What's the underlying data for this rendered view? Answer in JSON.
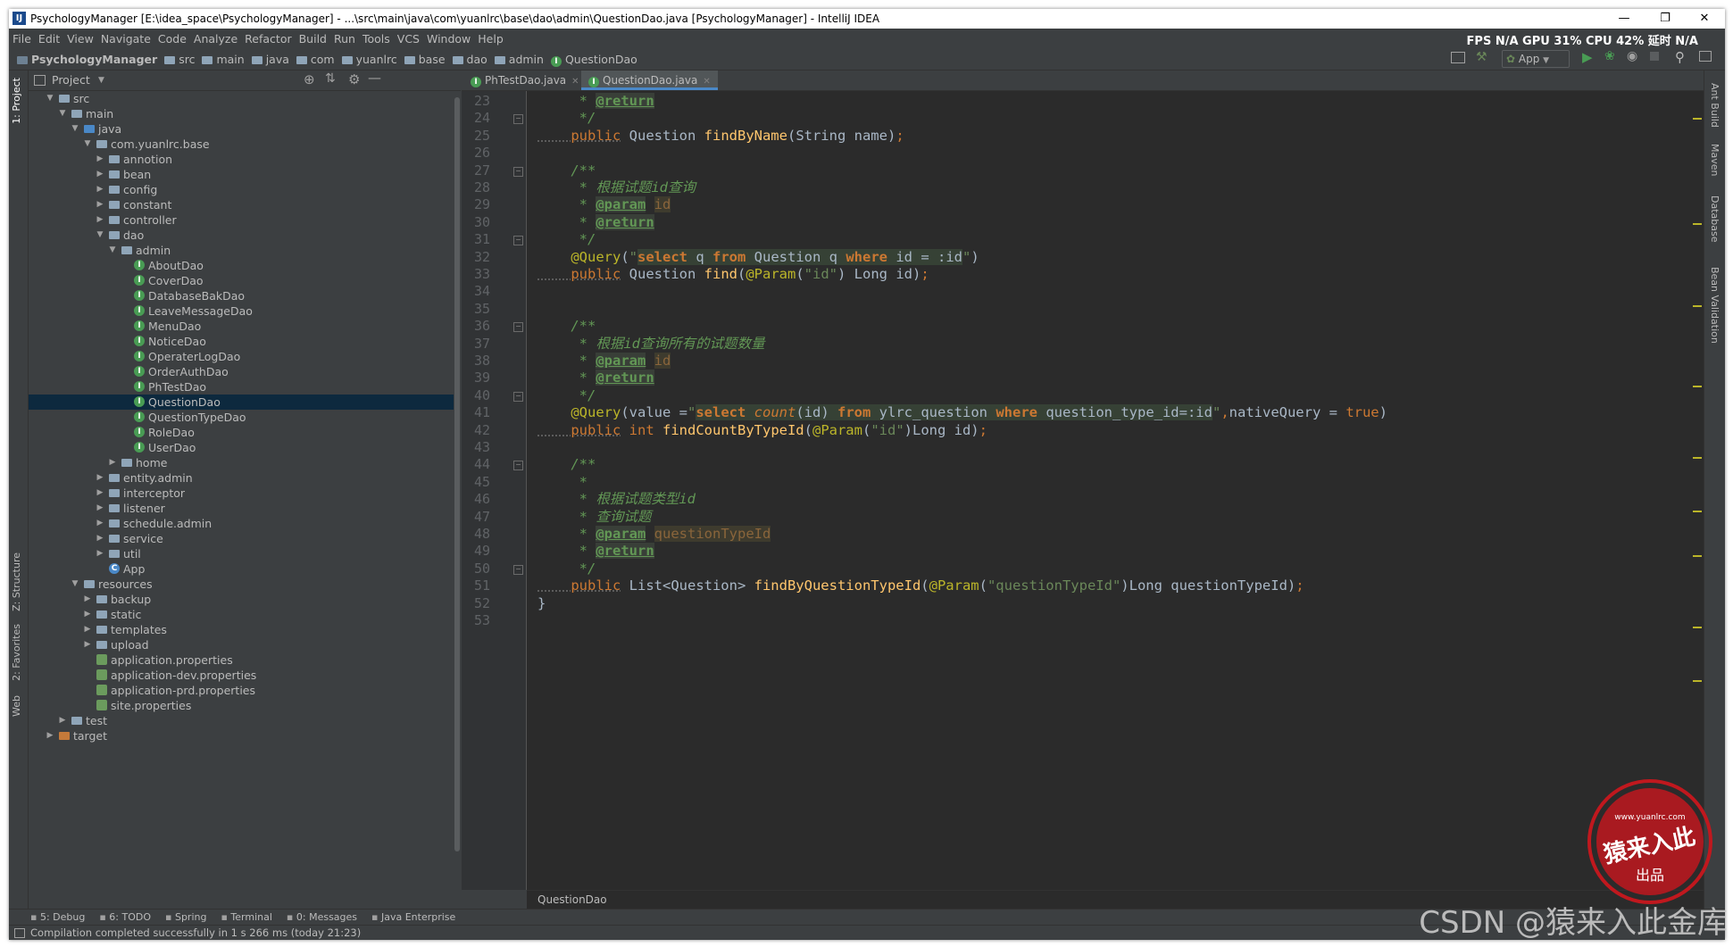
{
  "window": {
    "title": "PsychologyManager [E:\\idea_space\\PsychologyManager] - ...\\src\\main\\java\\com\\yuanlrc\\base\\dao\\admin\\QuestionDao.java [PsychologyManager] - IntelliJ IDEA",
    "app_icon": "IJ"
  },
  "menu": [
    "File",
    "Edit",
    "View",
    "Navigate",
    "Code",
    "Analyze",
    "Refactor",
    "Build",
    "Run",
    "Tools",
    "VCS",
    "Window",
    "Help"
  ],
  "stats": "FPS N/A GPU 31% CPU 42% 延时 N/A",
  "breadcrumb": [
    "PsychologyManager",
    "src",
    "main",
    "java",
    "com",
    "yuanlrc",
    "base",
    "dao",
    "admin",
    "QuestionDao"
  ],
  "run_config": "App",
  "project_panel": {
    "title": "Project"
  },
  "tree": [
    {
      "d": 1,
      "t": "folder",
      "open": true,
      "label": "src"
    },
    {
      "d": 2,
      "t": "folder",
      "open": true,
      "label": "main"
    },
    {
      "d": 3,
      "t": "folder",
      "open": true,
      "label": "java"
    },
    {
      "d": 4,
      "t": "folder",
      "open": true,
      "label": "com.yuanlrc.base"
    },
    {
      "d": 5,
      "t": "folder",
      "open": false,
      "label": "annotion"
    },
    {
      "d": 5,
      "t": "folder",
      "open": false,
      "label": "bean"
    },
    {
      "d": 5,
      "t": "folder",
      "open": false,
      "label": "config"
    },
    {
      "d": 5,
      "t": "folder",
      "open": false,
      "label": "constant"
    },
    {
      "d": 5,
      "t": "folder",
      "open": false,
      "label": "controller"
    },
    {
      "d": 5,
      "t": "folder",
      "open": true,
      "label": "dao"
    },
    {
      "d": 6,
      "t": "folder",
      "open": true,
      "label": "admin"
    },
    {
      "d": 7,
      "t": "class",
      "label": "AboutDao"
    },
    {
      "d": 7,
      "t": "class",
      "label": "CoverDao"
    },
    {
      "d": 7,
      "t": "class",
      "label": "DatabaseBakDao"
    },
    {
      "d": 7,
      "t": "class",
      "label": "LeaveMessageDao"
    },
    {
      "d": 7,
      "t": "class",
      "label": "MenuDao"
    },
    {
      "d": 7,
      "t": "class",
      "label": "NoticeDao"
    },
    {
      "d": 7,
      "t": "class",
      "label": "OperaterLogDao"
    },
    {
      "d": 7,
      "t": "class",
      "label": "OrderAuthDao"
    },
    {
      "d": 7,
      "t": "class",
      "label": "PhTestDao"
    },
    {
      "d": 7,
      "t": "class",
      "label": "QuestionDao",
      "selected": true
    },
    {
      "d": 7,
      "t": "class",
      "label": "QuestionTypeDao"
    },
    {
      "d": 7,
      "t": "class",
      "label": "RoleDao"
    },
    {
      "d": 7,
      "t": "class",
      "label": "UserDao"
    },
    {
      "d": 6,
      "t": "folder",
      "open": false,
      "label": "home"
    },
    {
      "d": 5,
      "t": "folder",
      "open": false,
      "label": "entity.admin"
    },
    {
      "d": 5,
      "t": "folder",
      "open": false,
      "label": "interceptor"
    },
    {
      "d": 5,
      "t": "folder",
      "open": false,
      "label": "listener"
    },
    {
      "d": 5,
      "t": "folder",
      "open": false,
      "label": "schedule.admin"
    },
    {
      "d": 5,
      "t": "folder",
      "open": false,
      "label": "service"
    },
    {
      "d": 5,
      "t": "folder",
      "open": false,
      "label": "util"
    },
    {
      "d": 5,
      "t": "app",
      "label": "App"
    },
    {
      "d": 3,
      "t": "folder",
      "open": true,
      "label": "resources"
    },
    {
      "d": 4,
      "t": "folder",
      "open": false,
      "label": "backup"
    },
    {
      "d": 4,
      "t": "folder",
      "open": false,
      "label": "static"
    },
    {
      "d": 4,
      "t": "folder",
      "open": false,
      "label": "templates"
    },
    {
      "d": 4,
      "t": "folder",
      "open": false,
      "label": "upload"
    },
    {
      "d": 4,
      "t": "prop",
      "label": "application.properties"
    },
    {
      "d": 4,
      "t": "prop",
      "label": "application-dev.properties"
    },
    {
      "d": 4,
      "t": "prop",
      "label": "application-prd.properties"
    },
    {
      "d": 4,
      "t": "prop",
      "label": "site.properties"
    },
    {
      "d": 2,
      "t": "folder",
      "open": false,
      "label": "test"
    },
    {
      "d": 1,
      "t": "folder",
      "open": false,
      "label": "target",
      "orange": true
    }
  ],
  "tabs": [
    {
      "label": "PhTestDao.java",
      "active": false
    },
    {
      "label": "QuestionDao.java",
      "active": true
    }
  ],
  "code": {
    "first_line": 23,
    "lines": [
      [
        [
          "doc",
          "     * "
        ],
        [
          "tag",
          "@return"
        ]
      ],
      [
        [
          "doc",
          "     */"
        ]
      ],
      [
        [
          "und kw",
          "    public"
        ],
        [
          "",
          " Question "
        ],
        [
          "fn",
          "findByName"
        ],
        [
          "",
          "(String name)"
        ],
        [
          "kw",
          ";"
        ]
      ],
      [
        [
          "",
          ""
        ]
      ],
      [
        [
          "doc",
          "    /**"
        ]
      ],
      [
        [
          "doc",
          "     * 根据试题id查询"
        ]
      ],
      [
        [
          "doc",
          "     * "
        ],
        [
          "tag",
          "@param"
        ],
        [
          "doc",
          " "
        ],
        [
          "par",
          "id"
        ]
      ],
      [
        [
          "doc",
          "     * "
        ],
        [
          "tag",
          "@return"
        ]
      ],
      [
        [
          "doc",
          "     */"
        ]
      ],
      [
        [
          "an",
          "    @Query"
        ],
        [
          "",
          "("
        ],
        [
          "str",
          "\""
        ],
        [
          "sq",
          "select"
        ],
        [
          "sqt",
          " q "
        ],
        [
          "sq",
          "from"
        ],
        [
          "sqt",
          " Question q "
        ],
        [
          "sq",
          "where"
        ],
        [
          "sqt",
          " id = :id"
        ],
        [
          "str",
          "\""
        ],
        [
          "",
          ")"
        ]
      ],
      [
        [
          "und kw",
          "    public"
        ],
        [
          "",
          " Question "
        ],
        [
          "fn",
          "find"
        ],
        [
          "",
          "("
        ],
        [
          "an",
          "@Param"
        ],
        [
          "",
          "("
        ],
        [
          "str",
          "\"id\""
        ],
        [
          "",
          ") Long id)"
        ],
        [
          "kw",
          ";"
        ]
      ],
      [
        [
          "",
          ""
        ]
      ],
      [
        [
          "",
          ""
        ]
      ],
      [
        [
          "doc",
          "    /**"
        ]
      ],
      [
        [
          "doc",
          "     * 根据id查询所有的试题数量"
        ]
      ],
      [
        [
          "doc",
          "     * "
        ],
        [
          "tag",
          "@param"
        ],
        [
          "doc",
          " "
        ],
        [
          "par",
          "id"
        ]
      ],
      [
        [
          "doc",
          "     * "
        ],
        [
          "tag",
          "@return"
        ]
      ],
      [
        [
          "doc",
          "     */"
        ]
      ],
      [
        [
          "an",
          "    @Query"
        ],
        [
          "",
          "(value ="
        ],
        [
          "str",
          "\""
        ],
        [
          "sq",
          "select"
        ],
        [
          "sqt",
          " "
        ],
        [
          "sqi",
          "count"
        ],
        [
          "sqt",
          "(id) "
        ],
        [
          "sq",
          "from"
        ],
        [
          "sqt",
          " ylrc_question "
        ],
        [
          "sq",
          "where"
        ],
        [
          "sqt",
          " question_type_id=:id"
        ],
        [
          "str",
          "\""
        ],
        [
          "kw",
          ","
        ],
        [
          "",
          "nativeQuery = "
        ],
        [
          "kw",
          "true"
        ],
        [
          "",
          ")"
        ]
      ],
      [
        [
          "und kw",
          "    public"
        ],
        [
          "kw",
          " int "
        ],
        [
          "fn",
          "findCountByTypeId"
        ],
        [
          "",
          "("
        ],
        [
          "an",
          "@Param"
        ],
        [
          "",
          "("
        ],
        [
          "str",
          "\"id\""
        ],
        [
          "",
          ")Long id)"
        ],
        [
          "kw",
          ";"
        ]
      ],
      [
        [
          "",
          ""
        ]
      ],
      [
        [
          "doc",
          "    /**"
        ]
      ],
      [
        [
          "doc",
          "     *"
        ]
      ],
      [
        [
          "doc",
          "     * 根据试题类型id"
        ]
      ],
      [
        [
          "doc",
          "     * 查询试题"
        ]
      ],
      [
        [
          "doc",
          "     * "
        ],
        [
          "tag",
          "@param"
        ],
        [
          "doc",
          " "
        ],
        [
          "par",
          "questionTypeId"
        ]
      ],
      [
        [
          "doc",
          "     * "
        ],
        [
          "tag",
          "@return"
        ]
      ],
      [
        [
          "doc",
          "     */"
        ]
      ],
      [
        [
          "und kw",
          "    public"
        ],
        [
          "",
          " List<Question> "
        ],
        [
          "fn",
          "findByQuestionTypeId"
        ],
        [
          "",
          "("
        ],
        [
          "an",
          "@Param"
        ],
        [
          "",
          "("
        ],
        [
          "str",
          "\"questionTypeId\""
        ],
        [
          "",
          ")Long questionTypeId)"
        ],
        [
          "kw",
          ";"
        ]
      ],
      [
        [
          "",
          "}"
        ]
      ],
      [
        [
          "",
          ""
        ]
      ]
    ]
  },
  "editor_crumb": "QuestionDao",
  "left_tabs": [
    "1: Project",
    "Z: Structure",
    "2: Favorites",
    "Web"
  ],
  "right_tabs": [
    "Ant Build",
    "Maven",
    "Database",
    "Bean Validation"
  ],
  "bottom_tools": [
    "5: Debug",
    "6: TODO",
    "Spring",
    "Terminal",
    "0: Messages",
    "Java Enterprise"
  ],
  "status_message": "Compilation completed successfully in 1 s 266 ms (today 21:23)",
  "watermark": "CSDN @猿来入此金库",
  "stamp_text": "猿来入此",
  "stamp_sub": "出品",
  "stamp_url": "www.yuanlrc.com"
}
